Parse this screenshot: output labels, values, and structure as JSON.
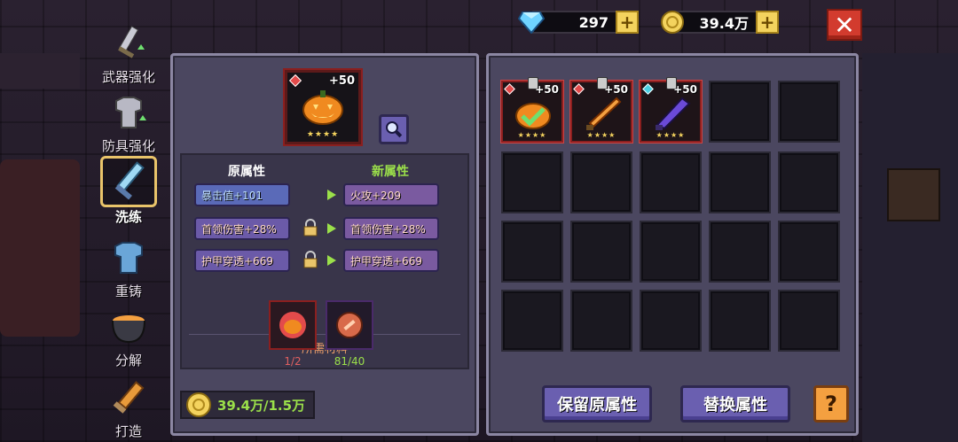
{
  "currency": {
    "gems": "297",
    "gold": "39.4万"
  },
  "nav": [
    {
      "label": "武器强化",
      "icon": "sword-upgrade-icon"
    },
    {
      "label": "防具强化",
      "icon": "armor-upgrade-icon"
    },
    {
      "label": "洗练",
      "icon": "reforge-sword-icon"
    },
    {
      "label": "重铸",
      "icon": "recast-armor-icon"
    },
    {
      "label": "分解",
      "icon": "cauldron-icon"
    },
    {
      "label": "打造",
      "icon": "hammer-icon"
    }
  ],
  "item": {
    "plus": "+50",
    "stars": "★★★★"
  },
  "attributes": {
    "old_title": "原属性",
    "new_title": "新属性",
    "old": [
      "暴击值+101",
      "首领伤害+28%",
      "护甲穿透+669"
    ],
    "new": [
      "火攻+209",
      "首领伤害+28%",
      "护甲穿透+669"
    ]
  },
  "materials": {
    "title": "所需材料",
    "items": [
      {
        "count": "1/2",
        "color": "#e06060"
      },
      {
        "count": "81/40",
        "color": "#9be04a"
      }
    ]
  },
  "gold_cost": "39.4万/1.5万",
  "inventory": [
    {
      "plus": "+50",
      "stars": "★★★★",
      "gem": "#e34b4b",
      "name": "pumpkin-equipped"
    },
    {
      "plus": "+50",
      "stars": "★★★★",
      "gem": "#e34b4b",
      "name": "fire-sword"
    },
    {
      "plus": "+50",
      "stars": "★★★★",
      "gem": "#4bd0e3",
      "name": "dark-blade"
    }
  ],
  "buttons": {
    "keep": "保留原属性",
    "replace": "替换属性",
    "help": "?"
  }
}
